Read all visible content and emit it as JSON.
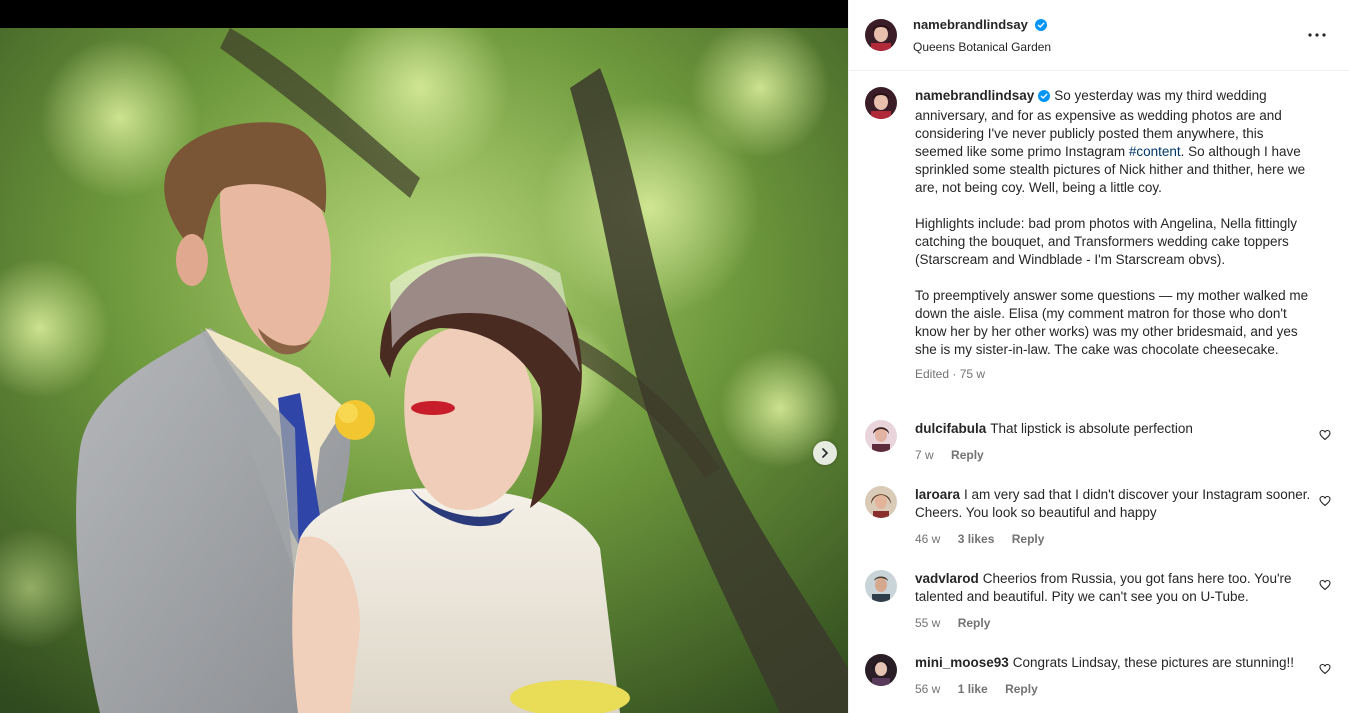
{
  "post": {
    "author": "namebrandlindsay",
    "location": "Queens Botanical Garden",
    "caption_author": "namebrandlindsay",
    "caption_intro": "So yesterday was my third wedding anniversary, and for as expensive as wedding photos are and considering I've never publicly posted them anywhere, this seemed like some primo Instagram ",
    "caption_hashtag": "#content",
    "caption_intro_end": ". So although I have sprinkled some stealth pictures of Nick hither and thither, here we are, not being coy. Well, being a little coy.",
    "caption_para2": "Highlights include: bad prom photos with Angelina, Nella fittingly catching the bouquet, and Transformers wedding cake toppers (Starscream and Windblade - I'm Starscream obvs).",
    "caption_para3": "To preemptively answer some questions — my mother walked me down the aisle. Elisa (my comment matron for those who don't know her by her other works) was my other bridesmaid, and yes she is my sister-in-law. The cake was chocolate cheesecake.",
    "caption_meta": "Edited · 75 w"
  },
  "comments": [
    {
      "user": "dulcifabula",
      "text": "That lipstick is absolute perfection",
      "time": "7 w",
      "likes": "",
      "reply": "Reply"
    },
    {
      "user": "laroara",
      "text": "I am very sad that I didn't discover your Instagram sooner. Cheers. You look so beautiful and happy",
      "time": "46 w",
      "likes": "3 likes",
      "reply": "Reply"
    },
    {
      "user": "vadvlarod",
      "text": "Cheerios from Russia, you got fans here too. You're talented and beautiful. Pity we can't see you on U-Tube.",
      "time": "55 w",
      "likes": "",
      "reply": "Reply"
    },
    {
      "user": "mini_moose93",
      "text": "Congrats Lindsay, these pictures are stunning!!",
      "time": "56 w",
      "likes": "1 like",
      "reply": "Reply"
    }
  ],
  "colors": {
    "verified": "#0095f6",
    "hashtag": "#00376b",
    "muted": "#737373"
  },
  "icons": {
    "verified": "verified-badge-icon",
    "more": "more-options-icon",
    "heart": "heart-outline-icon",
    "next": "chevron-right-icon"
  }
}
